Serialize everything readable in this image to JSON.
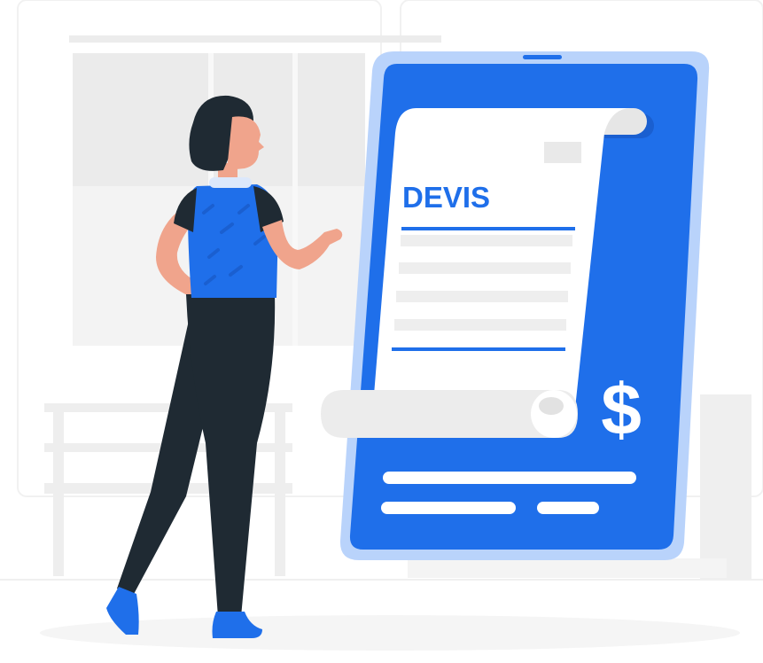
{
  "document": {
    "title": "DEVIS"
  },
  "tablet": {
    "currency_symbol": "$"
  },
  "icons": {
    "quote_document": "receipt-scroll-icon",
    "currency": "dollar-sign-icon",
    "person": "standing-woman-illustration"
  },
  "colors": {
    "primary_blue": "#1f6fea",
    "tablet_frame": "#b9d3fb",
    "paper": "#ffffff",
    "outfit_dark": "#1f2a33",
    "skin": "#f0a48c",
    "background_grey": "#f1f1f1"
  }
}
